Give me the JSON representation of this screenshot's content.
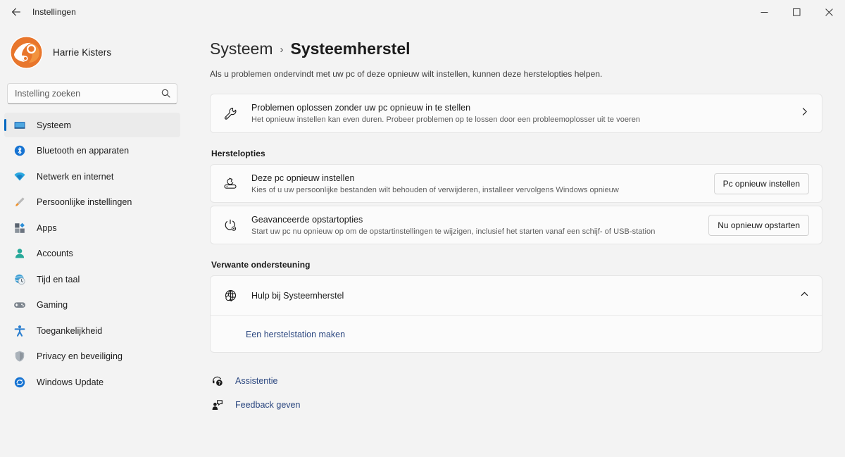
{
  "window": {
    "title": "Instellingen",
    "back_icon": "back-arrow-icon",
    "minimize_label": "—",
    "maximize_label": "□",
    "close_label": "✕"
  },
  "sidebar": {
    "account_name": "Harrie Kisters",
    "avatar_colors": {
      "primary": "#e8762c",
      "secondary": "#f2933f",
      "background": "#ffffff"
    },
    "search": {
      "placeholder": "Instelling zoeken",
      "value": "",
      "icon": "search-icon"
    },
    "items": [
      {
        "label": "Systeem",
        "icon": "monitor-icon",
        "selected": true
      },
      {
        "label": "Bluetooth en apparaten",
        "icon": "bluetooth-icon",
        "selected": false
      },
      {
        "label": "Netwerk en internet",
        "icon": "wifi-icon",
        "selected": false
      },
      {
        "label": "Persoonlijke instellingen",
        "icon": "paintbrush-icon",
        "selected": false
      },
      {
        "label": "Apps",
        "icon": "apps-grid-icon",
        "selected": false
      },
      {
        "label": "Accounts",
        "icon": "person-icon",
        "selected": false
      },
      {
        "label": "Tijd en taal",
        "icon": "clock-globe-icon",
        "selected": false
      },
      {
        "label": "Gaming",
        "icon": "gamepad-icon",
        "selected": false
      },
      {
        "label": "Toegankelijkheid",
        "icon": "accessibility-icon",
        "selected": false
      },
      {
        "label": "Privacy en beveiliging",
        "icon": "shield-icon",
        "selected": false
      },
      {
        "label": "Windows Update",
        "icon": "update-refresh-icon",
        "selected": false
      }
    ],
    "selected_accent": "#0067c0"
  },
  "main": {
    "breadcrumb": {
      "parent": "Systeem",
      "separator": "›",
      "current": "Systeemherstel"
    },
    "description": "Als u problemen ondervindt met uw pc of deze opnieuw wilt instellen, kunnen deze herstelopties helpen.",
    "troubleshoot_card": {
      "icon": "wrench-icon",
      "title": "Problemen oplossen zonder uw pc opnieuw in te stellen",
      "subtitle": "Het opnieuw instellen kan even duren. Probeer problemen op te lossen door een probleemoplosser uit te voeren",
      "chevron": "chevron-right-icon"
    },
    "recovery_section": {
      "label": "Herstelopties",
      "cards": [
        {
          "icon": "reset-pc-icon",
          "title": "Deze pc opnieuw instellen",
          "subtitle": "Kies of u uw persoonlijke bestanden wilt behouden of verwijderen, installeer vervolgens Windows opnieuw",
          "button": "Pc opnieuw instellen"
        },
        {
          "icon": "power-settings-icon",
          "title": "Geavanceerde opstartopties",
          "subtitle": "Start uw pc nu opnieuw op om de opstartinstellingen te wijzigen, inclusief het starten vanaf een schijf- of USB-station",
          "button": "Nu opnieuw opstarten"
        }
      ]
    },
    "related_section": {
      "label": "Verwante ondersteuning",
      "expander": {
        "icon": "globe-icon",
        "title": "Hulp bij Systeemherstel",
        "chevron": "chevron-up-icon",
        "expanded": true,
        "links": [
          {
            "label": "Een herstelstation maken"
          }
        ]
      }
    },
    "footer_links": [
      {
        "label": "Assistentie",
        "icon": "help-headset-icon"
      },
      {
        "label": "Feedback geven",
        "icon": "feedback-icon"
      }
    ],
    "link_color": "#2a467f"
  }
}
